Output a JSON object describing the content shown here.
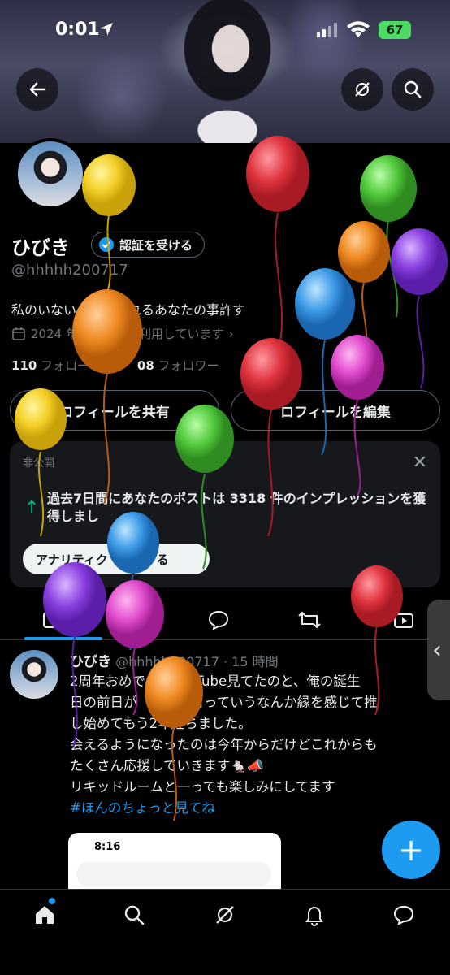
{
  "status_bar": {
    "time": "0:01",
    "battery": "67"
  },
  "profile": {
    "name": "ひびき",
    "verify_label": "認証を受ける",
    "handle": "@hhhhh200717",
    "bio": "私のいない　　生きれるあなたの事許す",
    "joined": "2024 年　　　　を利用しています",
    "following_count": "110",
    "following_label": "フォロー",
    "followers_count": "08",
    "followers_label": "フォロワー"
  },
  "buttons": {
    "share": "ロフィールを共有",
    "edit": "ロフィールを編集"
  },
  "private_card": {
    "label": "非公開",
    "text": "過去7日間にあなたのポストは 3318 件のインプレッションを獲得しまし",
    "analytics_label": "アナリティク　　用する"
  },
  "post": {
    "name": "ひびき",
    "handle_time": "@hhhhh200717 · 15 時間",
    "line1": "2周年おめで　　YouTube見てたのと、俺の誕生",
    "line2": "日の前日が　　　一日っていうなんか縁を感じて推",
    "line3": "し始めてもう2年経ちました。",
    "line4": "会えるようになったのは今年からだけどこれからも",
    "line5": "たくさん応援していきます🐁📣",
    "line6": "リキッドルームと一っても楽しみにしてます",
    "hashtag": "#ほんのちょっと見てね",
    "embed_time": "8:16"
  },
  "colors": {
    "accent": "#1d9bf0",
    "background": "#000000",
    "muted": "#71767b"
  },
  "icons": [
    "back-arrow-icon",
    "grok-icon",
    "search-icon",
    "calendar-icon",
    "verified-badge-icon",
    "close-icon",
    "up-arrow-icon",
    "media-icon",
    "reply-icon",
    "repost-icon",
    "video-icon",
    "home-icon",
    "notifications-icon",
    "messages-icon",
    "plus-icon"
  ]
}
